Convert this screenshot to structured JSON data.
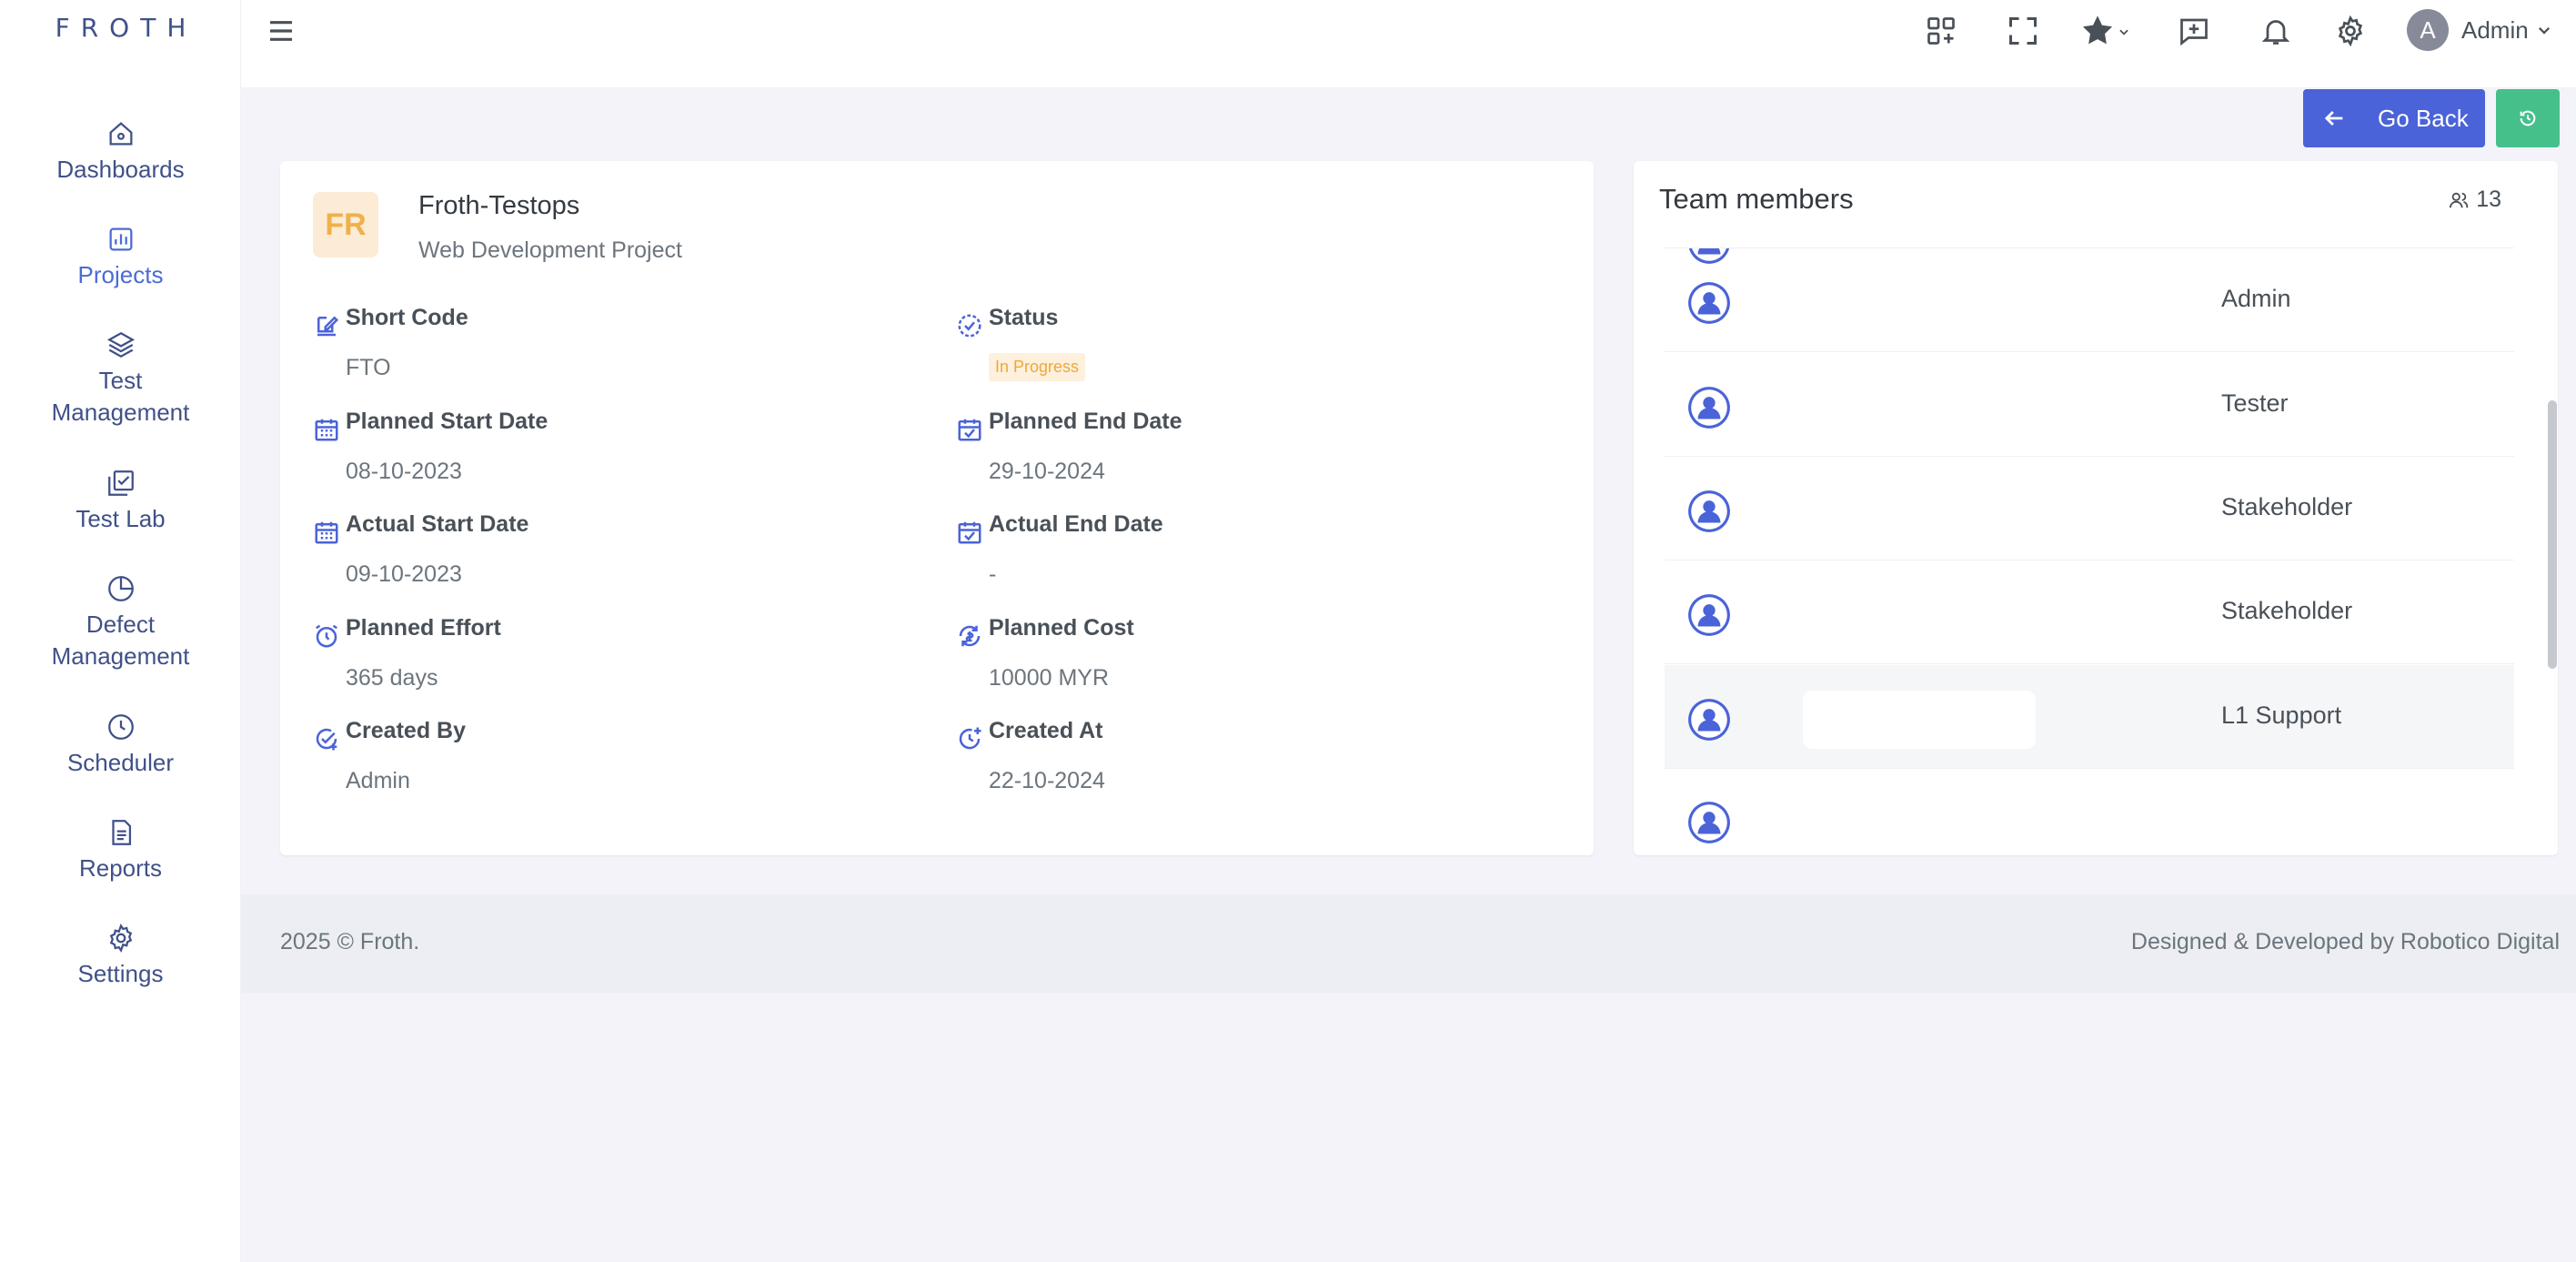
{
  "brand": "FROTH",
  "sidebar": {
    "items": [
      {
        "label": "Dashboards",
        "icon": "home-icon"
      },
      {
        "label": "Projects",
        "icon": "bar-chart-icon"
      },
      {
        "label": "Test Management",
        "icon": "layers-icon"
      },
      {
        "label": "Test Lab",
        "icon": "checklist-icon"
      },
      {
        "label": "Defect Management",
        "icon": "pie-chart-icon"
      },
      {
        "label": "Scheduler",
        "icon": "clock-icon"
      },
      {
        "label": "Reports",
        "icon": "file-icon"
      },
      {
        "label": "Settings",
        "icon": "gear-icon"
      }
    ]
  },
  "topbar": {
    "user_initial": "A",
    "user_name": "Admin"
  },
  "actions": {
    "go_back": "Go Back"
  },
  "project": {
    "initials": "FR",
    "name": "Froth-Testops",
    "type": "Web Development Project",
    "short_code_label": "Short Code",
    "short_code": "FTO",
    "status_label": "Status",
    "status": "In Progress",
    "planned_start_label": "Planned Start Date",
    "planned_start": "08-10-2023",
    "planned_end_label": "Planned End Date",
    "planned_end": "29-10-2024",
    "actual_start_label": "Actual Start Date",
    "actual_start": "09-10-2023",
    "actual_end_label": "Actual End Date",
    "actual_end": "-",
    "planned_effort_label": "Planned Effort",
    "planned_effort": "365 days",
    "planned_cost_label": "Planned Cost",
    "planned_cost": "10000 MYR",
    "created_by_label": "Created By",
    "created_by": "Admin",
    "created_at_label": "Created At",
    "created_at": "22-10-2024"
  },
  "team": {
    "title": "Team members",
    "count": "13",
    "members": [
      {
        "role": "Admin"
      },
      {
        "role": "Tester"
      },
      {
        "role": "Stakeholder"
      },
      {
        "role": "Stakeholder"
      },
      {
        "role": "L1 Support"
      }
    ]
  },
  "footer": {
    "copyright": "2025 © Froth.",
    "credit": "Designed & Developed by Robotico Digital"
  },
  "colors": {
    "primary": "#4b63d8",
    "success": "#45c08b",
    "warning": "#f0a73b",
    "badge_bg": "#fcecd5"
  }
}
